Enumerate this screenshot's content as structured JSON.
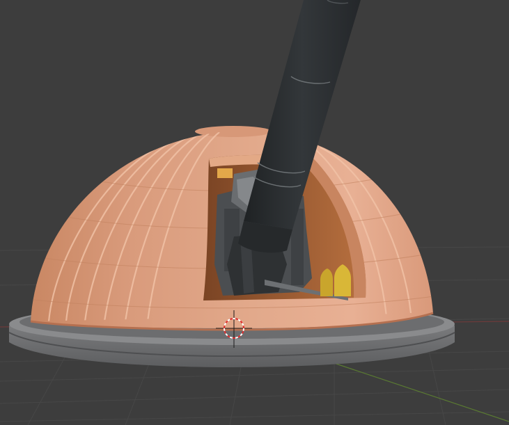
{
  "viewport": {
    "background": "#3d3d3d",
    "grid_color": "#4a4a4a",
    "axis_x_color": "#7a3b3b",
    "axis_y_color": "#5d7a33"
  },
  "model": {
    "dome_color": "#d99a7c",
    "dome_shadow": "#b97655",
    "base_color": "#6e6f71",
    "barrel_color": "#2c2f31",
    "gun_body_color": "#4a4d50",
    "shell_color": "#d8b43a"
  },
  "cursor_3d": {
    "name": "3d-cursor"
  }
}
